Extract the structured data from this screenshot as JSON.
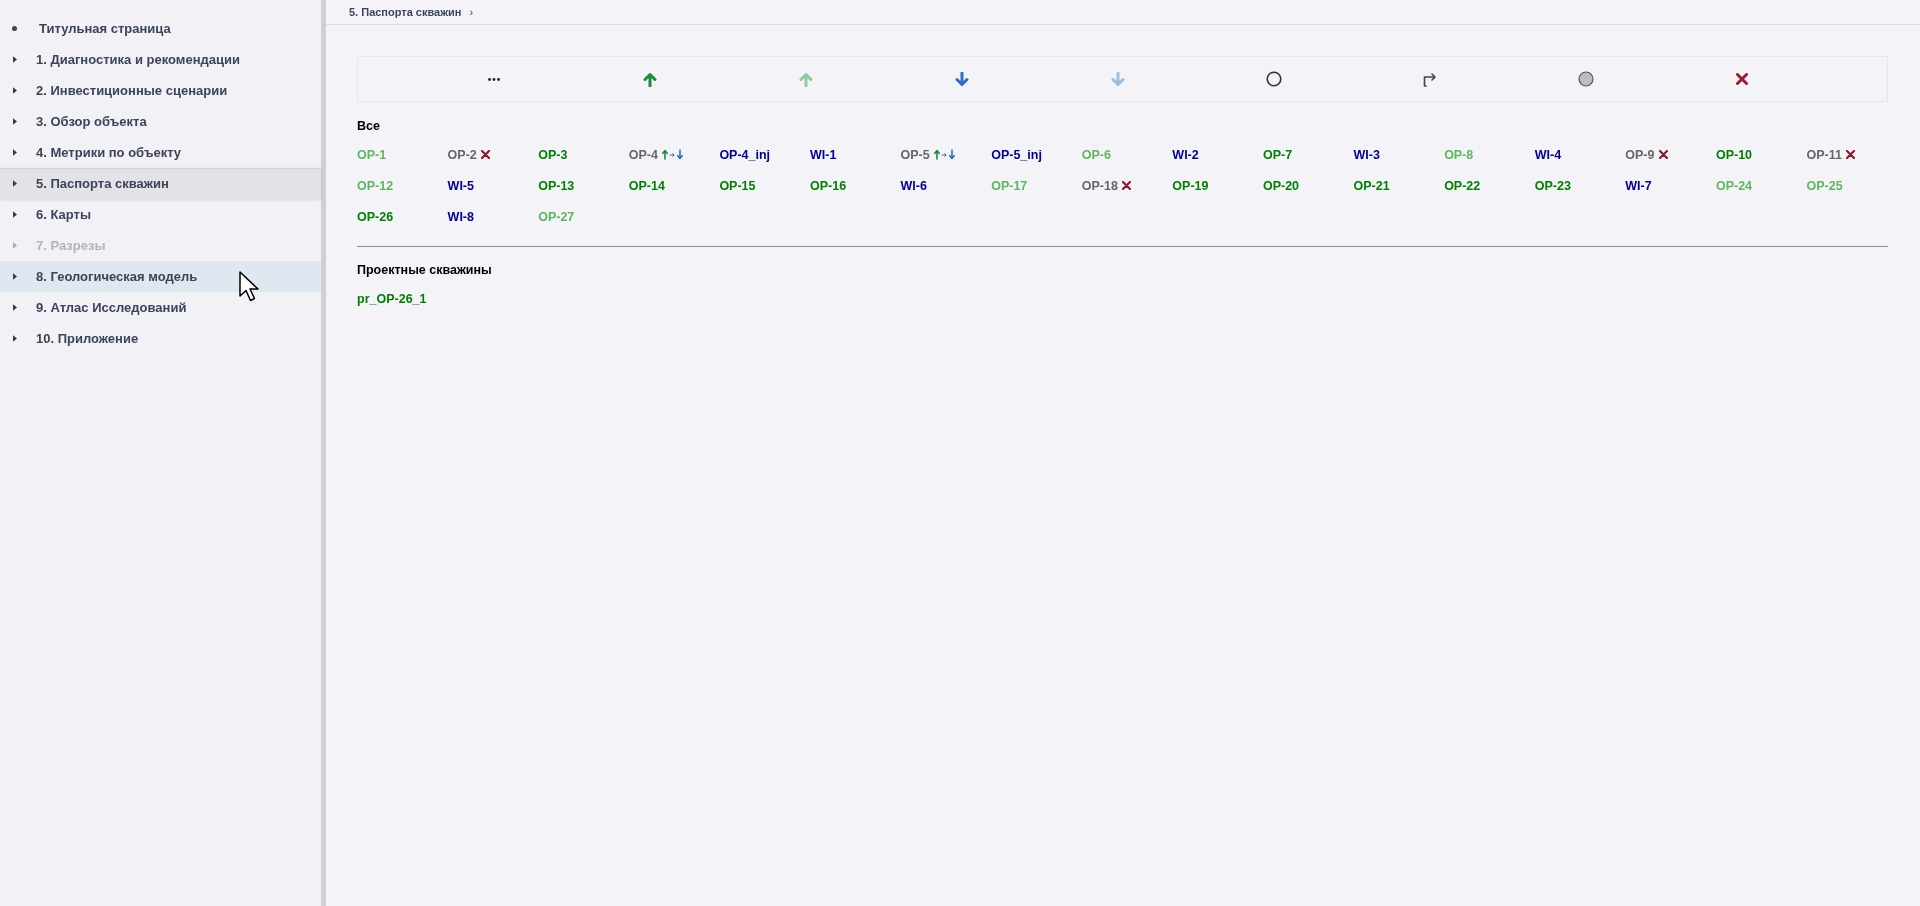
{
  "sidebar": {
    "items": [
      {
        "label": "Титульная страница",
        "kind": "leaf",
        "selected": false,
        "disabled": false,
        "hovered": false
      },
      {
        "label": "1. Диагностика и рекомендации",
        "kind": "branch",
        "selected": false,
        "disabled": false,
        "hovered": false
      },
      {
        "label": "2. Инвестиционные сценарии",
        "kind": "branch",
        "selected": false,
        "disabled": false,
        "hovered": false
      },
      {
        "label": "3. Обзор объекта",
        "kind": "branch",
        "selected": false,
        "disabled": false,
        "hovered": false
      },
      {
        "label": "4. Метрики по объекту",
        "kind": "branch",
        "selected": false,
        "disabled": false,
        "hovered": false
      },
      {
        "label": "5. Паспорта скважин",
        "kind": "branch",
        "selected": true,
        "disabled": false,
        "hovered": false
      },
      {
        "label": "6. Карты",
        "kind": "branch",
        "selected": false,
        "disabled": false,
        "hovered": false
      },
      {
        "label": "7. Разрезы",
        "kind": "branch",
        "selected": false,
        "disabled": true,
        "hovered": false
      },
      {
        "label": "8. Геологическая модель",
        "kind": "branch",
        "selected": false,
        "disabled": false,
        "hovered": true
      },
      {
        "label": "9. Атлас Исследований",
        "kind": "branch",
        "selected": false,
        "disabled": false,
        "hovered": false
      },
      {
        "label": "10. Приложение",
        "kind": "branch",
        "selected": false,
        "disabled": false,
        "hovered": false
      }
    ]
  },
  "breadcrumb": {
    "label": "5. Паспорта скважин",
    "separator": "›"
  },
  "sections": [
    {
      "title": "Все",
      "wells": [
        {
          "name": "OP-1",
          "color": "#5cb85c",
          "kind": "plain"
        },
        {
          "name": "OP-2",
          "color": "#666666",
          "kind": "abandoned"
        },
        {
          "name": "OP-3",
          "color": "#008000",
          "kind": "plain"
        },
        {
          "name": "OP-4",
          "color": "#666666",
          "kind": "converted"
        },
        {
          "name": "OP-4_inj",
          "color": "#000099",
          "kind": "plain"
        },
        {
          "name": "WI-1",
          "color": "#000099",
          "kind": "plain"
        },
        {
          "name": "OP-5",
          "color": "#666666",
          "kind": "converted"
        },
        {
          "name": "OP-5_inj",
          "color": "#000099",
          "kind": "plain"
        },
        {
          "name": "OP-6",
          "color": "#5cb85c",
          "kind": "plain"
        },
        {
          "name": "WI-2",
          "color": "#000099",
          "kind": "plain"
        },
        {
          "name": "OP-7",
          "color": "#008000",
          "kind": "plain"
        },
        {
          "name": "WI-3",
          "color": "#000099",
          "kind": "plain"
        },
        {
          "name": "OP-8",
          "color": "#5cb85c",
          "kind": "plain"
        },
        {
          "name": "WI-4",
          "color": "#000099",
          "kind": "plain"
        },
        {
          "name": "OP-9",
          "color": "#666666",
          "kind": "abandoned"
        },
        {
          "name": "OP-10",
          "color": "#008000",
          "kind": "plain"
        },
        {
          "name": "OP-11",
          "color": "#666666",
          "kind": "abandoned"
        },
        {
          "name": "OP-12",
          "color": "#5cb85c",
          "kind": "plain"
        },
        {
          "name": "WI-5",
          "color": "#000099",
          "kind": "plain"
        },
        {
          "name": "OP-13",
          "color": "#008000",
          "kind": "plain"
        },
        {
          "name": "OP-14",
          "color": "#008000",
          "kind": "plain"
        },
        {
          "name": "OP-15",
          "color": "#008000",
          "kind": "plain"
        },
        {
          "name": "OP-16",
          "color": "#008000",
          "kind": "plain"
        },
        {
          "name": "WI-6",
          "color": "#000099",
          "kind": "plain"
        },
        {
          "name": "OP-17",
          "color": "#5cb85c",
          "kind": "plain"
        },
        {
          "name": "OP-18",
          "color": "#666666",
          "kind": "abandoned"
        },
        {
          "name": "OP-19",
          "color": "#008000",
          "kind": "plain"
        },
        {
          "name": "OP-20",
          "color": "#008000",
          "kind": "plain"
        },
        {
          "name": "OP-21",
          "color": "#008000",
          "kind": "plain"
        },
        {
          "name": "OP-22",
          "color": "#008000",
          "kind": "plain"
        },
        {
          "name": "OP-23",
          "color": "#008000",
          "kind": "plain"
        },
        {
          "name": "WI-7",
          "color": "#000099",
          "kind": "plain"
        },
        {
          "name": "OP-24",
          "color": "#5cb85c",
          "kind": "plain"
        },
        {
          "name": "OP-25",
          "color": "#5cb85c",
          "kind": "plain"
        },
        {
          "name": "OP-26",
          "color": "#008000",
          "kind": "plain"
        },
        {
          "name": "WI-8",
          "color": "#000099",
          "kind": "plain"
        },
        {
          "name": "OP-27",
          "color": "#5cb85c",
          "kind": "plain"
        }
      ]
    },
    {
      "title": "Проектные скважины",
      "wells": [
        {
          "name": "pr_OP-26_1",
          "color": "#008000",
          "kind": "plain"
        }
      ]
    }
  ]
}
